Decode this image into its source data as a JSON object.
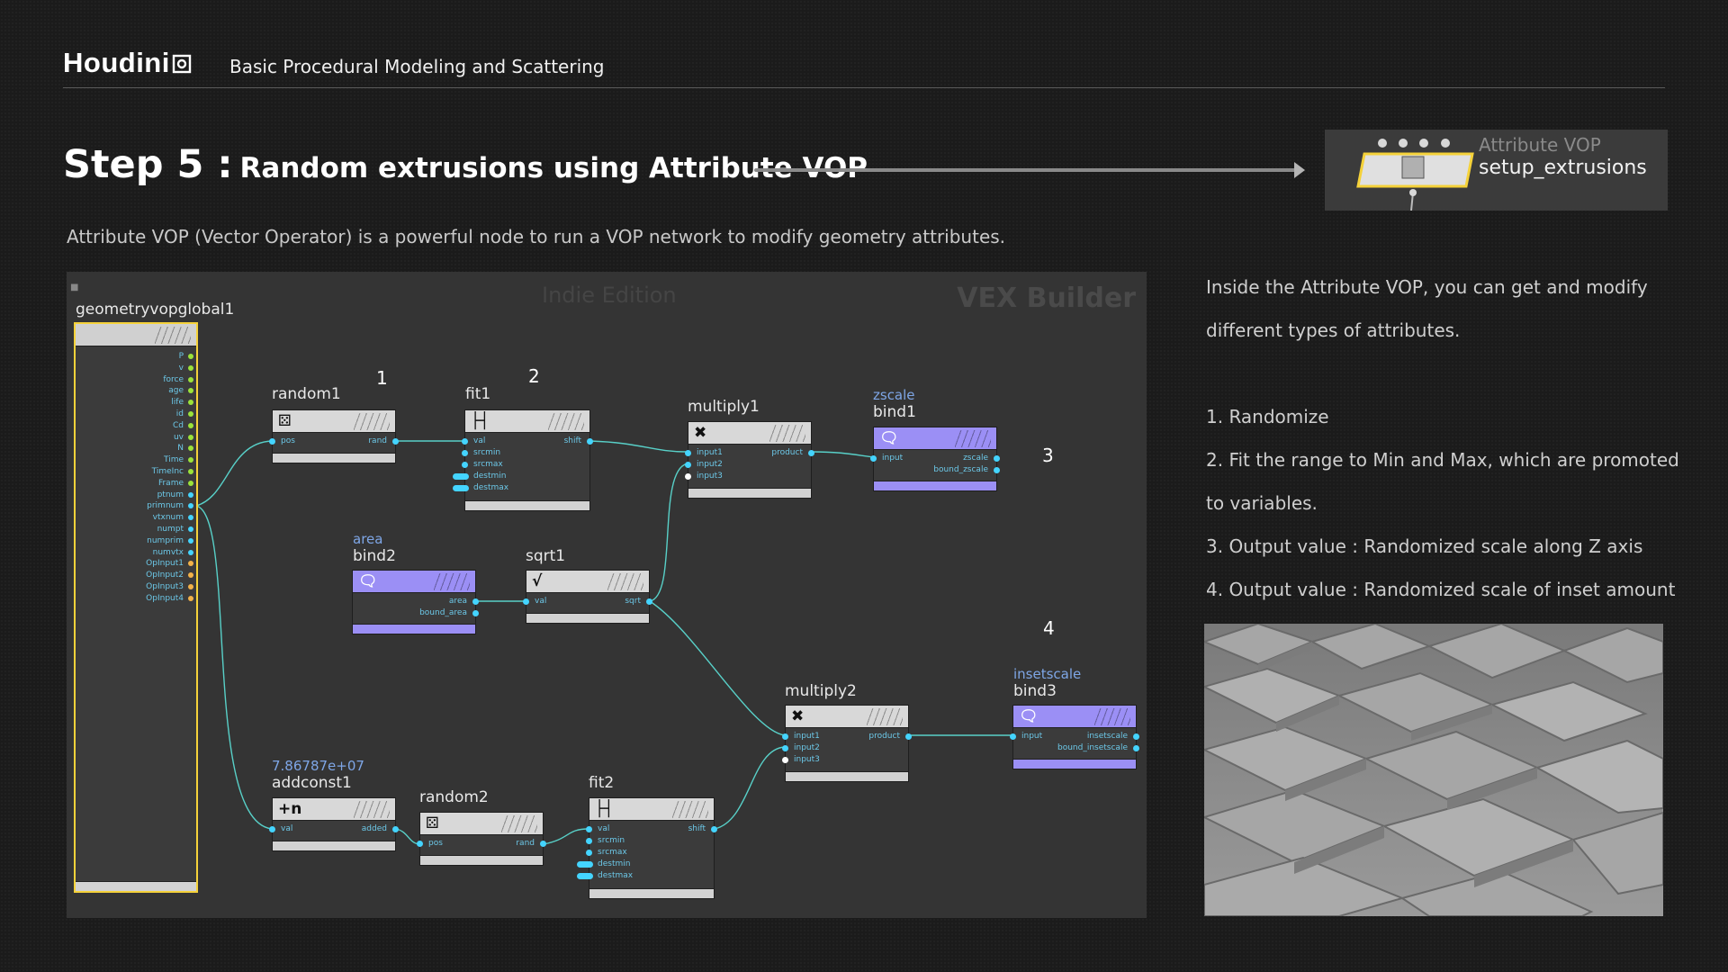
{
  "header": {
    "logo": "Houdini",
    "course_title": "Basic Procedural Modeling and Scattering"
  },
  "step": {
    "label": "Step 5 :",
    "title": "Random extrusions using Attribute VOP"
  },
  "vop_node": {
    "type": "Attribute VOP",
    "name": "setup_extrusions"
  },
  "intro": "Attribute VOP (Vector Operator) is a powerful node to run a VOP network to modify geometry attributes.",
  "network": {
    "watermark": "Indie Edition",
    "context": "VEX Builder",
    "numbers": [
      "1",
      "2",
      "3",
      "4"
    ],
    "global_node": {
      "name": "geometryvopglobal1",
      "outputs": [
        "P",
        "v",
        "force",
        "age",
        "life",
        "id",
        "Cd",
        "uv",
        "N",
        "Time",
        "TimeInc",
        "Frame",
        "ptnum",
        "primnum",
        "vtxnum",
        "numpt",
        "numprim",
        "numvtx",
        "OpInput1",
        "OpInput2",
        "OpInput3",
        "OpInput4"
      ]
    },
    "nodes": {
      "random1": {
        "name": "random1",
        "in": [
          "pos"
        ],
        "out": [
          "rand"
        ]
      },
      "fit1": {
        "name": "fit1",
        "in": [
          "val",
          "srcmin",
          "srcmax",
          "destmin",
          "destmax"
        ],
        "out": [
          "shift"
        ]
      },
      "multiply1": {
        "name": "multiply1",
        "in": [
          "input1",
          "input2",
          "input3"
        ],
        "out": [
          "product"
        ]
      },
      "bind1": {
        "sub": "zscale",
        "name": "bind1",
        "in": [
          "input"
        ],
        "out": [
          "zscale",
          "bound_zscale"
        ]
      },
      "bind2": {
        "sub": "area",
        "name": "bind2",
        "out": [
          "area",
          "bound_area"
        ]
      },
      "sqrt1": {
        "name": "sqrt1",
        "in": [
          "val"
        ],
        "out": [
          "sqrt"
        ]
      },
      "multiply2": {
        "name": "multiply2",
        "in": [
          "input1",
          "input2",
          "input3"
        ],
        "out": [
          "product"
        ]
      },
      "bind3": {
        "sub": "insetscale",
        "name": "bind3",
        "in": [
          "input"
        ],
        "out": [
          "insetscale",
          "bound_insetscale"
        ]
      },
      "addconst1": {
        "sub": "7.86787e+07",
        "name": "addconst1",
        "in": [
          "val"
        ],
        "out": [
          "added"
        ]
      },
      "random2": {
        "name": "random2",
        "in": [
          "pos"
        ],
        "out": [
          "rand"
        ]
      },
      "fit2": {
        "name": "fit2",
        "in": [
          "val",
          "srcmin",
          "srcmax",
          "destmin",
          "destmax"
        ],
        "out": [
          "shift"
        ]
      }
    }
  },
  "description": [
    "Inside the Attribute VOP, you can get and modify",
    "different types of attributes.",
    "",
    "1. Randomize",
    "2. Fit the range to Min and Max, which are promoted",
    "to variables.",
    "3. Output value : Randomized scale along Z axis",
    "4. Output value : Randomized scale of inset amount"
  ],
  "colors": {
    "background": "#1b1b1b",
    "network_bg": "#343434",
    "bind_node": "#9b8ff5",
    "wire": "#58d0c8",
    "port": "#44d4ff",
    "highlight": "#f5d23a"
  }
}
